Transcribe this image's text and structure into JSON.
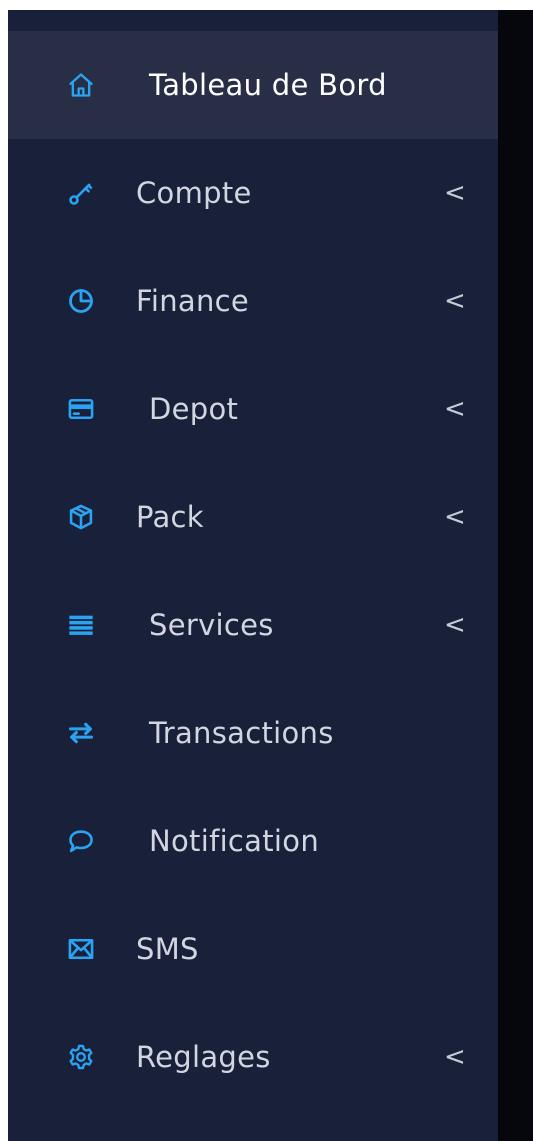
{
  "theme": {
    "sidebar_bg": "#19203a",
    "active_bg": "#272e45",
    "icon_color": "#2aa3f2",
    "text_color": "#d2d6e1",
    "active_text_color": "#ffffff"
  },
  "sidebar": {
    "items": [
      {
        "label": "Tableau de Bord",
        "icon": "home-icon",
        "active": true,
        "has_submenu": false
      },
      {
        "label": "Compte",
        "icon": "key-icon",
        "active": false,
        "has_submenu": true
      },
      {
        "label": "Finance",
        "icon": "pie-chart-icon",
        "active": false,
        "has_submenu": true
      },
      {
        "label": "Depot",
        "icon": "credit-card-icon",
        "active": false,
        "has_submenu": true
      },
      {
        "label": "Pack",
        "icon": "package-box-icon",
        "active": false,
        "has_submenu": true
      },
      {
        "label": "Services",
        "icon": "list-icon",
        "active": false,
        "has_submenu": true
      },
      {
        "label": "Transactions",
        "icon": "exchange-arrows-icon",
        "active": false,
        "has_submenu": false
      },
      {
        "label": "Notification",
        "icon": "chat-bubble-icon",
        "active": false,
        "has_submenu": false
      },
      {
        "label": "SMS",
        "icon": "envelope-icon",
        "active": false,
        "has_submenu": false
      },
      {
        "label": "Reglages",
        "icon": "gear-icon",
        "active": false,
        "has_submenu": true
      }
    ],
    "chevron_glyph": "<"
  }
}
